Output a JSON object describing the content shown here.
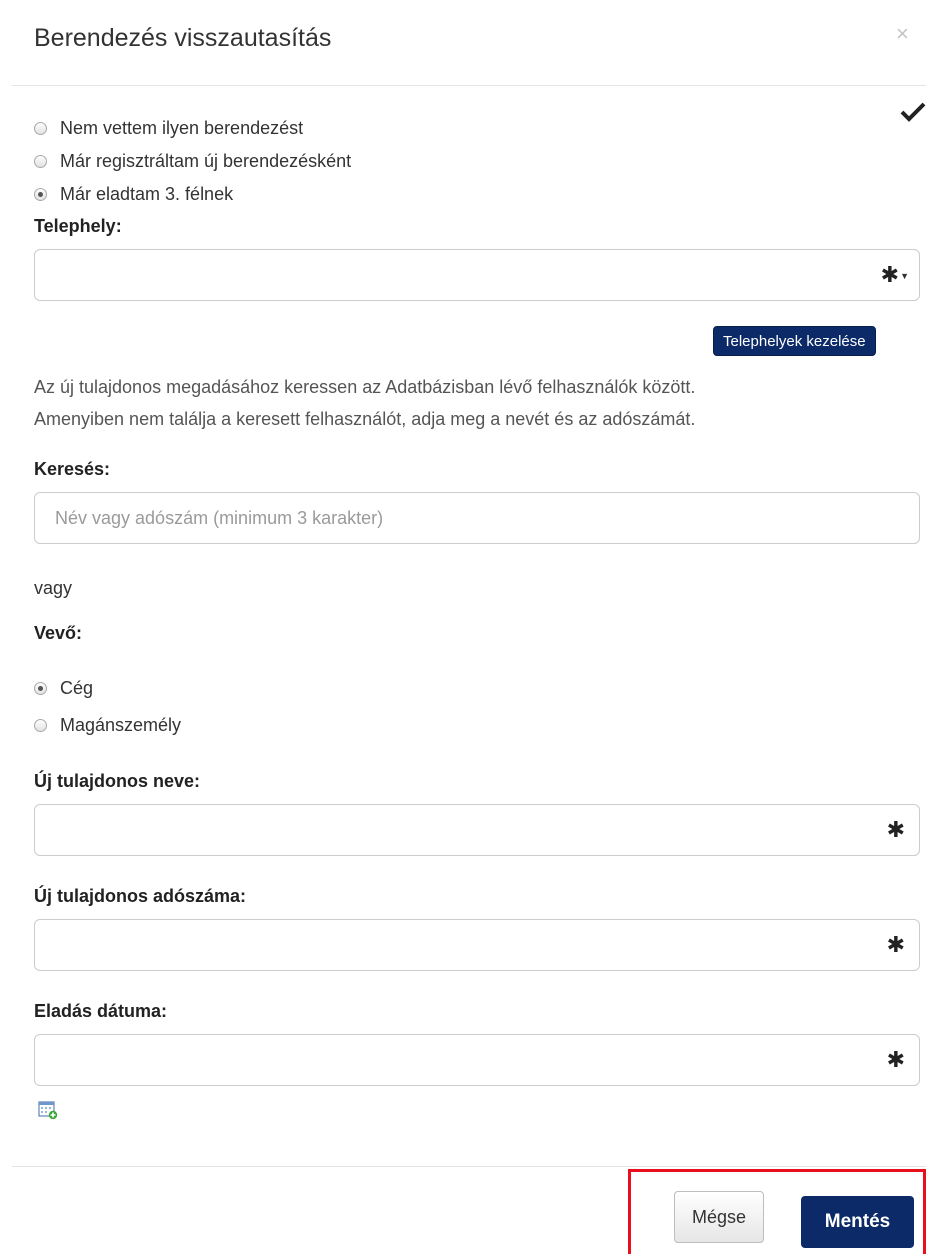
{
  "dialog": {
    "title": "Berendezés visszautasítás",
    "close_label": "×"
  },
  "refusal_options": [
    {
      "label": "Nem vettem ilyen berendezést",
      "checked": false
    },
    {
      "label": "Már regisztráltam új berendezésként",
      "checked": false
    },
    {
      "label": "Már eladtam 3. félnek",
      "checked": true
    }
  ],
  "site": {
    "label": "Telephely:",
    "value": "",
    "required_mark": "✱",
    "manage_button": "Telephelyek kezelése"
  },
  "info_text": {
    "line1": "Az új tulajdonos megadásához keressen az Adatbázisban lévő felhasználók között.",
    "line2": "Amenyiben nem találja a keresett felhasználót, adja meg a nevét és az adószámát."
  },
  "search": {
    "label": "Keresés:",
    "placeholder": "Név vagy adószám (minimum 3 karakter)",
    "value": ""
  },
  "or_text": "vagy",
  "buyer": {
    "label": "Vevő:",
    "options": [
      {
        "label": "Cég",
        "checked": true
      },
      {
        "label": "Magánszemély",
        "checked": false
      }
    ]
  },
  "owner_name": {
    "label": "Új tulajdonos neve:",
    "value": "",
    "required_mark": "✱"
  },
  "owner_tax": {
    "label": "Új tulajdonos adószáma:",
    "value": "",
    "required_mark": "✱"
  },
  "sale_date": {
    "label": "Eladás dátuma:",
    "value": "",
    "required_mark": "✱"
  },
  "footer": {
    "cancel_label": "Mégse",
    "save_label": "Mentés"
  },
  "icons": {
    "close": "close-icon",
    "check": "checkmark-icon",
    "calendar": "calendar-icon",
    "dropdown": "chevron-down-icon"
  },
  "colors": {
    "primary": "#0b2a67",
    "highlight": "#e8101e"
  }
}
